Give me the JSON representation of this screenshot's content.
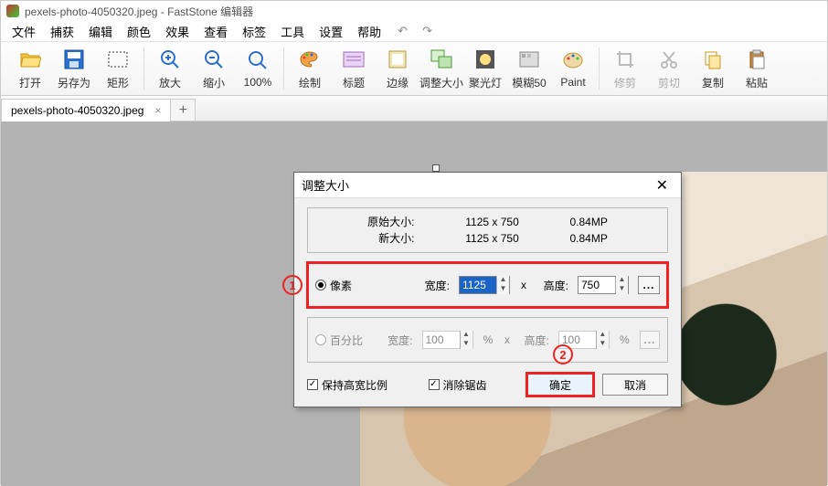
{
  "titlebar": {
    "filename": "pexels-photo-4050320.jpeg",
    "app": "FastStone 编辑器"
  },
  "menu": {
    "items": [
      "文件",
      "捕获",
      "编辑",
      "颜色",
      "效果",
      "查看",
      "标签",
      "工具",
      "设置",
      "帮助"
    ]
  },
  "toolbar": {
    "open": "打开",
    "saveas": "另存为",
    "rect": "矩形",
    "zoomin": "放大",
    "zoomout": "缩小",
    "zoom100": "100%",
    "draw": "绘制",
    "caption": "标题",
    "edge": "边缘",
    "resize": "调整大小",
    "spot": "聚光灯",
    "blur": "模糊50",
    "paint": "Paint",
    "crop": "修剪",
    "cut": "剪切",
    "copy": "复制",
    "paste": "粘贴"
  },
  "tab": {
    "name": "pexels-photo-4050320.jpeg"
  },
  "dialog": {
    "title": "调整大小",
    "orig_lbl": "原始大小:",
    "orig_dim": "1125 x 750",
    "orig_mp": "0.84MP",
    "new_lbl": "新大小:",
    "new_dim": "1125 x 750",
    "new_mp": "0.84MP",
    "px_label": "像素",
    "pct_label": "百分比",
    "width_lbl": "宽度:",
    "height_lbl": "高度:",
    "width_val": "1125",
    "height_val": "750",
    "pct_w": "100",
    "pct_h": "100",
    "keep_ratio": "保持高宽比例",
    "antialias": "消除锯齿",
    "ok": "确定",
    "cancel": "取消",
    "annot1": "1",
    "annot2": "2",
    "dots": "...",
    "x": "x",
    "pct_sym": "%"
  }
}
